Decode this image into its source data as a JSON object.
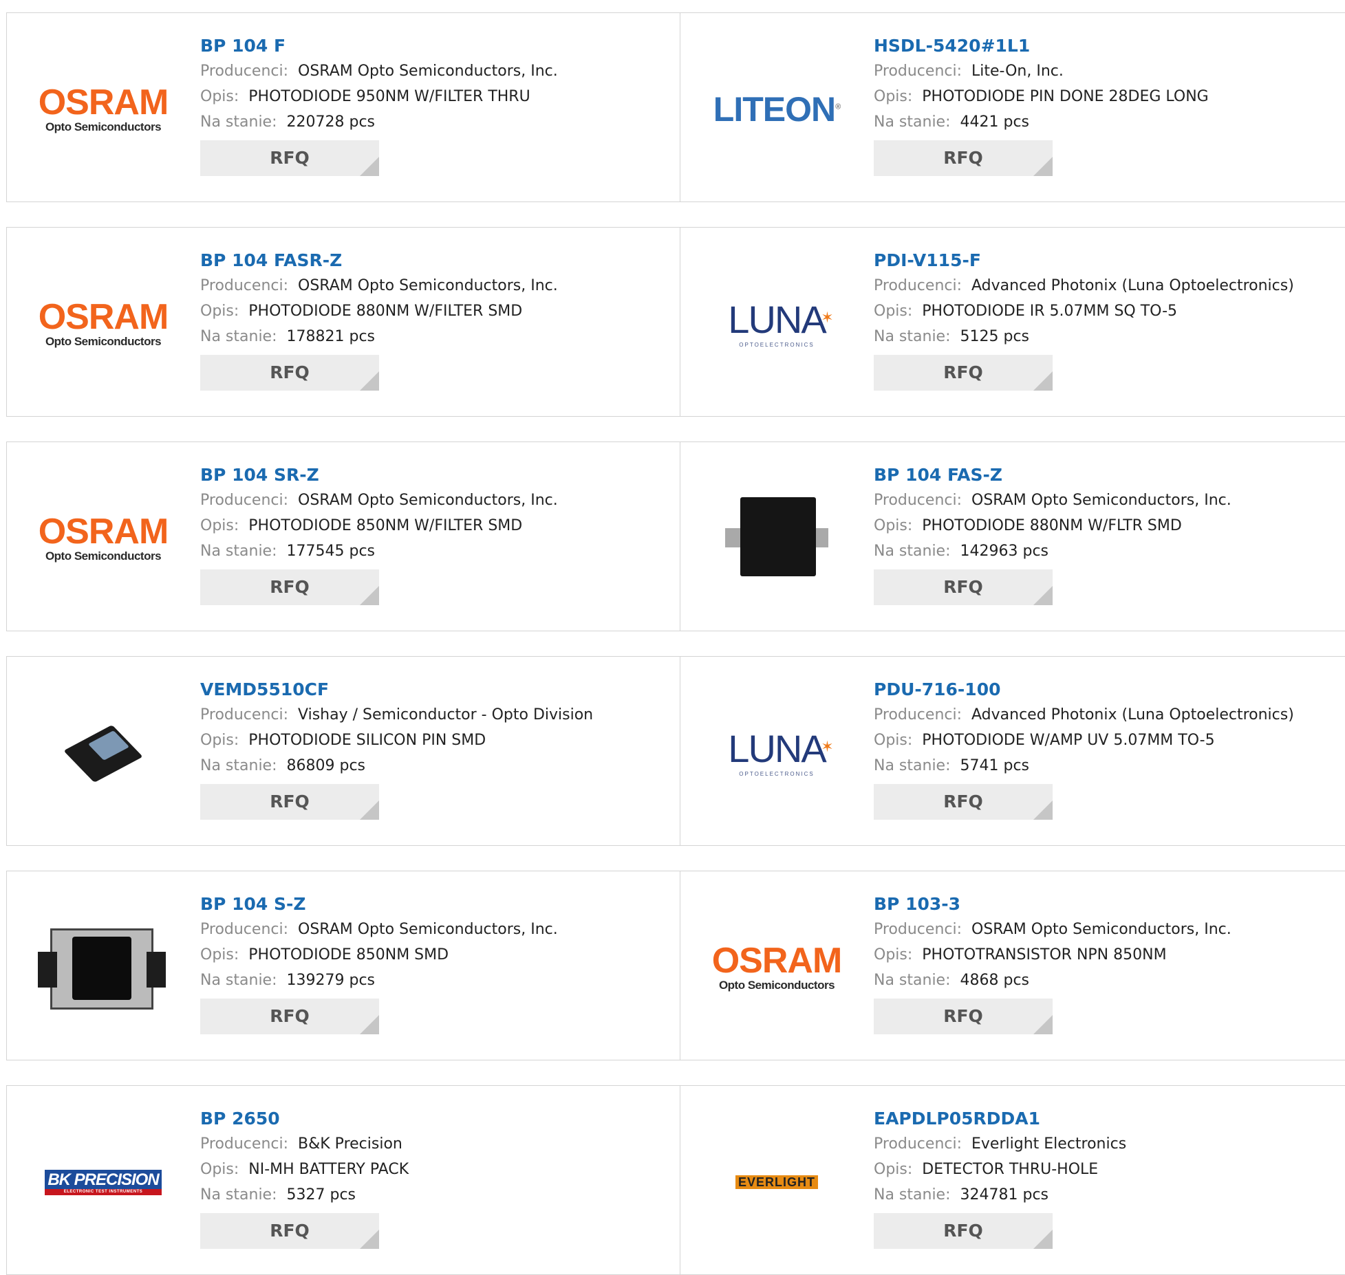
{
  "labels": {
    "manufacturer": "Producenci:",
    "description": "Opis:",
    "stock": "Na stanie:",
    "rfq": "RFQ"
  },
  "products": [
    {
      "part": "BP 104 F",
      "manufacturer": "OSRAM Opto Semiconductors, Inc.",
      "description": "PHOTODIODE 950NM W/FILTER THRU",
      "stock": "220728 pcs",
      "logo": "osram-logo"
    },
    {
      "part": "HSDL-5420#1L1",
      "manufacturer": "Lite-On, Inc.",
      "description": "PHOTODIODE PIN DONE 28DEG LONG",
      "stock": "4421 pcs",
      "logo": "liteon-logo"
    },
    {
      "part": "BP 104 FASR-Z",
      "manufacturer": "OSRAM Opto Semiconductors, Inc.",
      "description": "PHOTODIODE 880NM W/FILTER SMD",
      "stock": "178821 pcs",
      "logo": "osram-logo"
    },
    {
      "part": "PDI-V115-F",
      "manufacturer": "Advanced Photonix (Luna Optoelectronics)",
      "description": "PHOTODIODE IR 5.07MM SQ TO-5",
      "stock": "5125 pcs",
      "logo": "luna-logo"
    },
    {
      "part": "BP 104 SR-Z",
      "manufacturer": "OSRAM Opto Semiconductors, Inc.",
      "description": "PHOTODIODE 850NM W/FILTER SMD",
      "stock": "177545 pcs",
      "logo": "osram-logo"
    },
    {
      "part": "BP 104 FAS-Z",
      "manufacturer": "OSRAM Opto Semiconductors, Inc.",
      "description": "PHOTODIODE 880NM W/FLTR SMD",
      "stock": "142963 pcs",
      "logo": "chip-photo"
    },
    {
      "part": "VEMD5510CF",
      "manufacturer": "Vishay / Semiconductor - Opto Division",
      "description": "PHOTODIODE SILICON PIN SMD",
      "stock": "86809 pcs",
      "logo": "chip-iso-photo"
    },
    {
      "part": "PDU-716-100",
      "manufacturer": "Advanced Photonix (Luna Optoelectronics)",
      "description": "PHOTODIODE W/AMP UV 5.07MM TO-5",
      "stock": "5741 pcs",
      "logo": "luna-logo"
    },
    {
      "part": "BP 104 S-Z",
      "manufacturer": "OSRAM Opto Semiconductors, Inc.",
      "description": "PHOTODIODE 850NM SMD",
      "stock": "139279 pcs",
      "logo": "chip-sz-photo"
    },
    {
      "part": "BP 103-3",
      "manufacturer": "OSRAM Opto Semiconductors, Inc.",
      "description": "PHOTOTRANSISTOR NPN 850NM",
      "stock": "4868 pcs",
      "logo": "osram-logo"
    },
    {
      "part": "BP 2650",
      "manufacturer": "B&K Precision",
      "description": "NI-MH BATTERY PACK",
      "stock": "5327 pcs",
      "logo": "bk-precision-logo"
    },
    {
      "part": "EAPDLP05RDDA1",
      "manufacturer": "Everlight Electronics",
      "description": "DETECTOR THRU-HOLE",
      "stock": "324781 pcs",
      "logo": "everlight-logo"
    }
  ],
  "logos": {
    "osram": {
      "name": "OSRAM",
      "tagline": "Opto Semiconductors",
      "color": "#f2641c"
    },
    "liteon": {
      "name": "LITEON",
      "color": "#2f6fb6"
    },
    "luna": {
      "name": "LUNA",
      "tagline": "OPTOELECTRONICS",
      "color": "#233a7a"
    },
    "bk": {
      "name": "BK PRECISION",
      "tagline": "ELECTRONIC TEST INSTRUMENTS",
      "color": "#1c4c9b"
    },
    "everlight": {
      "name": "EVERLIGHT",
      "color": "#e78b13"
    }
  },
  "colors": {
    "part_link": "#1a6ab0",
    "label": "#8a8a8a",
    "button_bg": "#ececec"
  }
}
